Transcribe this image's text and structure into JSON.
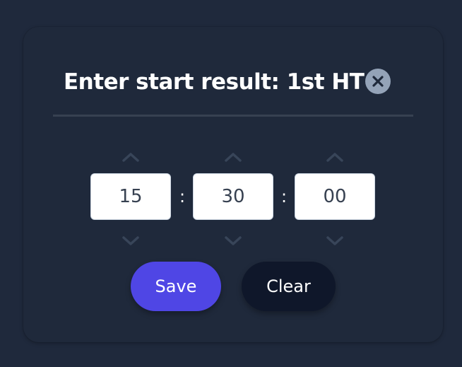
{
  "dialog": {
    "title": "Enter start result: 1st HT",
    "close_icon": "close-icon"
  },
  "time": {
    "hours": "15",
    "minutes": "30",
    "seconds": "00",
    "separator": ":"
  },
  "actions": {
    "save_label": "Save",
    "clear_label": "Clear"
  },
  "colors": {
    "background": "#1f293c",
    "accent": "#4f46e5",
    "clear_button": "#0f172a",
    "close_button": "#94a3b8",
    "chevron": "#384559"
  }
}
